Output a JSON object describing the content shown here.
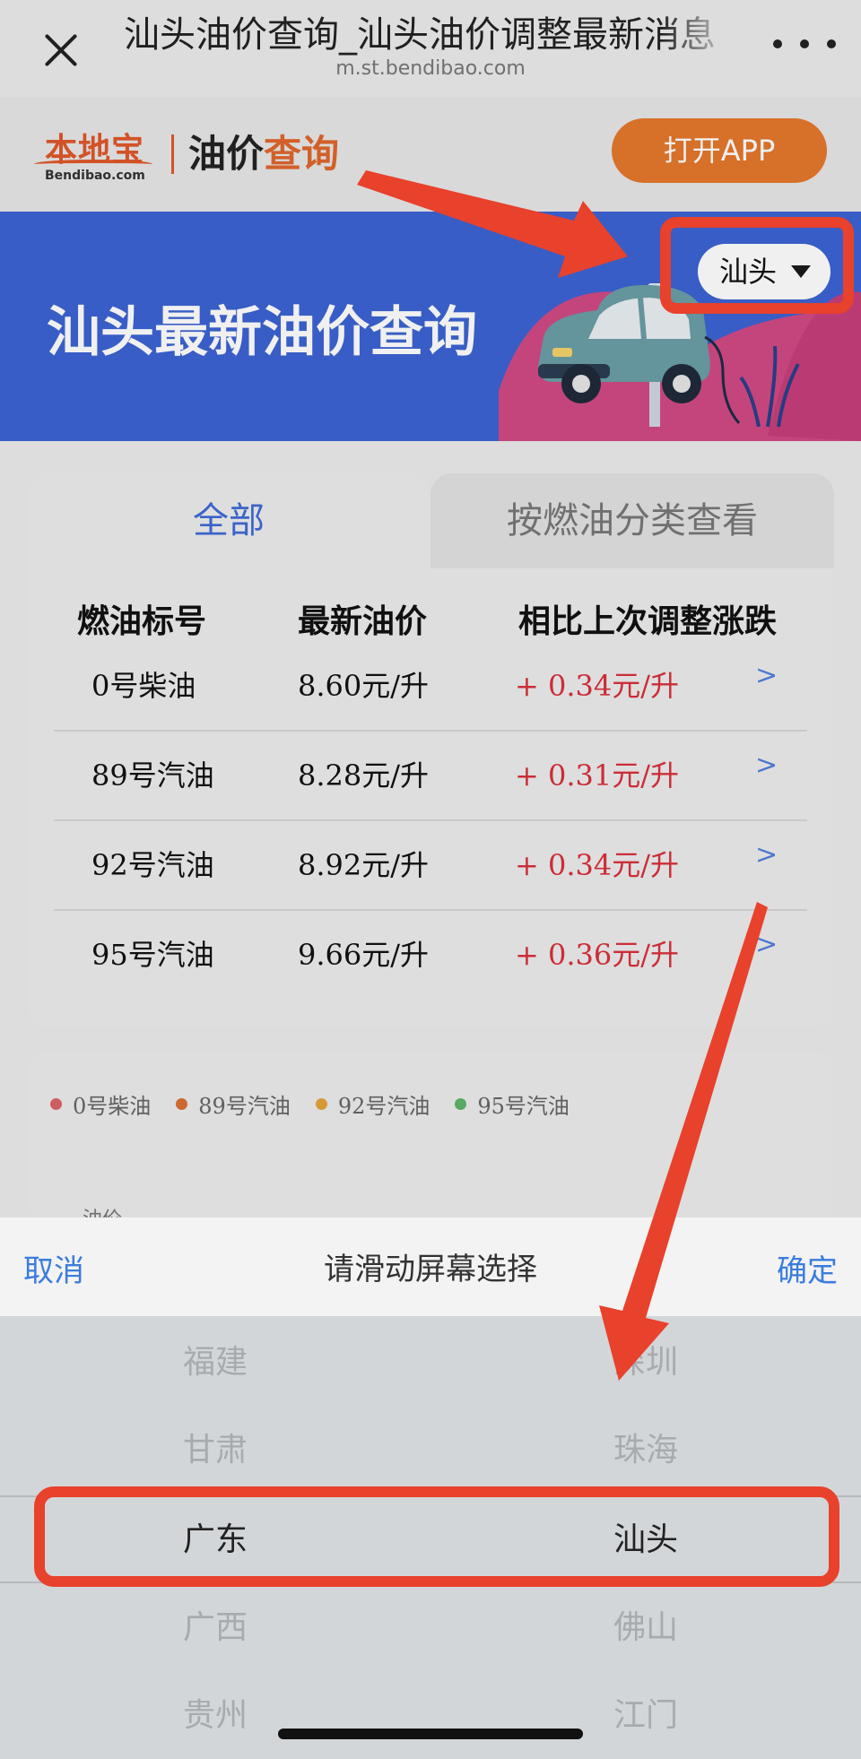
{
  "topbar": {
    "title": "汕头油价查询_汕头油价调整最新消息",
    "url": "m.st.bendibao.com"
  },
  "site_header": {
    "logo_name": "本地宝",
    "logo_sub": "Bendibao.com",
    "title_plain": "油价",
    "title_accent": "查询",
    "open_app_label": "打开APP"
  },
  "banner": {
    "title": "汕头最新油价查询",
    "city": "汕头"
  },
  "tabs": [
    {
      "label": "全部",
      "active": true
    },
    {
      "label": "按燃油分类查看",
      "active": false
    }
  ],
  "table": {
    "headers": [
      "燃油标号",
      "最新油价",
      "相比上次调整涨跌"
    ],
    "rows": [
      {
        "fuel": "0号柴油",
        "price": "8.60元/升",
        "change": "+ 0.34元/升",
        "chevron": ">"
      },
      {
        "fuel": "89号汽油",
        "price": "8.28元/升",
        "change": "+ 0.31元/升",
        "chevron": ">"
      },
      {
        "fuel": "92号汽油",
        "price": "8.92元/升",
        "change": "+ 0.34元/升",
        "chevron": ">"
      },
      {
        "fuel": "95号汽油",
        "price": "9.66元/升",
        "change": "+ 0.36元/升",
        "chevron": ">"
      }
    ]
  },
  "chart_legend": [
    {
      "label": "0号柴油",
      "color": "#d9646a"
    },
    {
      "label": "89号汽油",
      "color": "#db6f33"
    },
    {
      "label": "92号汽油",
      "color": "#e3a43c"
    },
    {
      "label": "95号汽油",
      "color": "#5fb36a"
    }
  ],
  "chart_axis_label": "油价",
  "picker": {
    "cancel_label": "取消",
    "prompt": "请滑动屏幕选择",
    "confirm_label": "确定",
    "provinces": [
      "福建",
      "甘肃",
      "广东",
      "广西",
      "贵州"
    ],
    "cities": [
      "深圳",
      "珠海",
      "汕头",
      "佛山",
      "江门"
    ],
    "selected_province": "广东",
    "selected_city": "汕头"
  },
  "colors": {
    "brand_orange": "#e5772c",
    "banner_blue": "#3c63d3",
    "link_blue": "#3b7cdc",
    "increase_red": "#d9303a",
    "annotation_red": "#e8412c"
  }
}
